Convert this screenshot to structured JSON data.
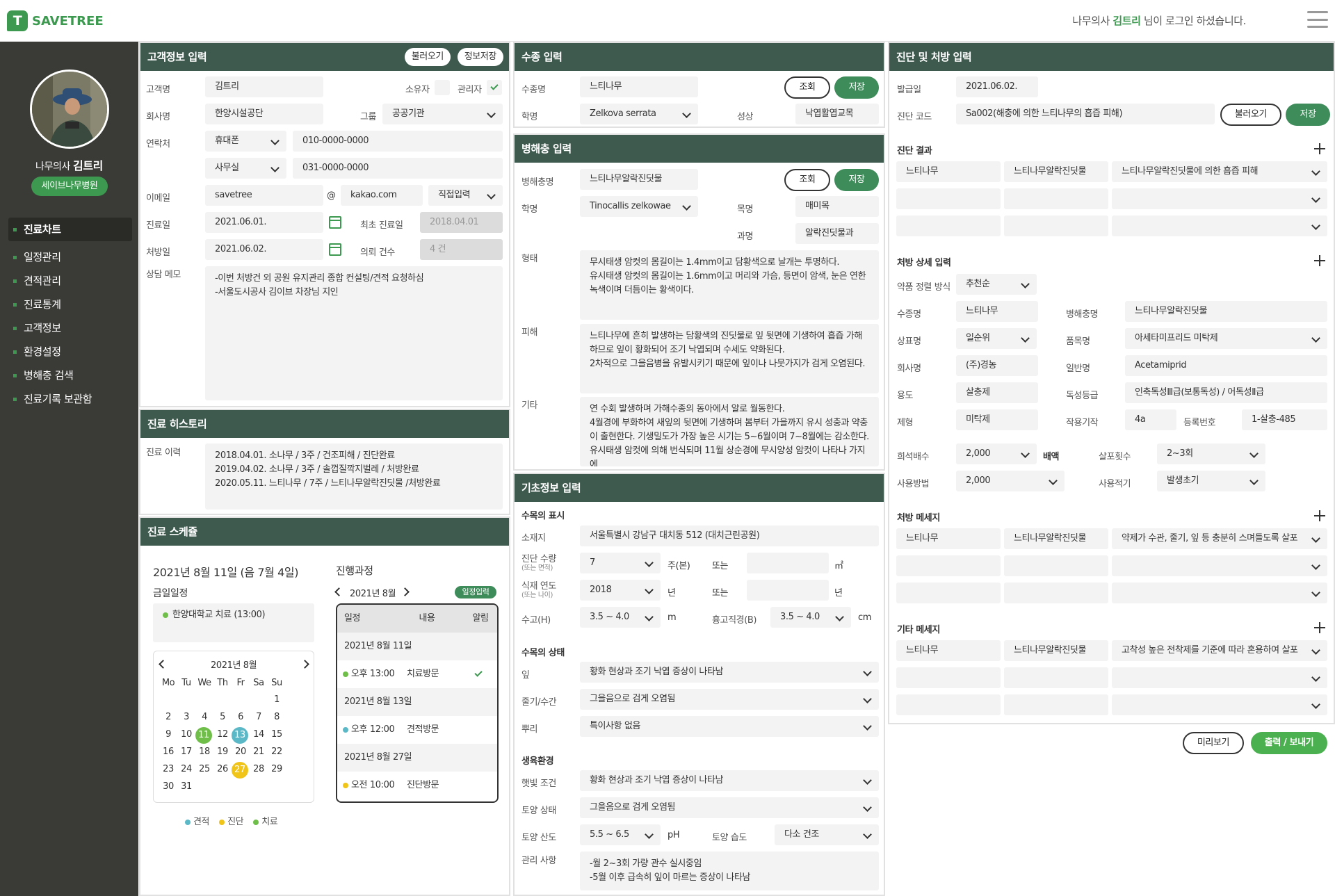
{
  "brand": {
    "logo_letter": "T",
    "name": "SAVETREE"
  },
  "header": {
    "login_prefix": "나무의사",
    "user_name": "김트리",
    "login_suffix": "님이 로그인 하셨습니다."
  },
  "profile": {
    "title": "나무의사",
    "name": "김트리",
    "hospital": "세이브나무병원"
  },
  "nav": [
    "진료차트",
    "일정관리",
    "견적관리",
    "진료통계",
    "고객정보",
    "환경설정",
    "병해충 검색",
    "진료기록 보관함"
  ],
  "customer": {
    "title": "고객정보 입력",
    "load_btn": "불러오기",
    "save_btn": "정보저장",
    "name_label": "고객명",
    "name": "김트리",
    "owner_label": "소유자",
    "manager_label": "관리자",
    "company_label": "회사명",
    "company": "한양시설공단",
    "group_label": "그룹",
    "group": "공공기관",
    "contact_label": "연락처",
    "phone1_type": "휴대폰",
    "phone1": "010-0000-0000",
    "phone2_type": "사무실",
    "phone2": "031-0000-0000",
    "email_label": "이메일",
    "email_id": "savetree",
    "at": "@",
    "email_domain": "kakao.com",
    "email_select": "직접입력",
    "visit_label": "진료일",
    "visit_date": "2021.06.01.",
    "first_visit_label": "최초 진료일",
    "first_visit": "2018.04.01",
    "rx_label": "처방일",
    "rx_date": "2021.06.02.",
    "requests_label": "의뢰 건수",
    "requests": "4 건",
    "memo_label": "상담 메모",
    "memo": "-이번 처방건 외 공원 유지관리 종합 컨설팅/견적 요청하심\n-서울도시공사 김이브 차장님 지인"
  },
  "history": {
    "title": "진료 히스토리",
    "label": "진료 이력",
    "text": "2018.04.01. 소나무 / 3주 / 건조피해 / 진단완료\n2019.04.02. 소나무 / 3주 / 솔껍질깍지벌레 / 처방완료\n2020.05.11. 느티나무 / 7주 / 느티나무알락진딧물 /처방완료"
  },
  "schedule": {
    "title": "진료 스케쥴",
    "today": "2021년 8월 11일 (음 7월 4일)",
    "today_label": "금일일정",
    "today_item": "한양대학교 치료 (13:00)",
    "cal_month": "2021년 8월",
    "weekdays": [
      "Mo",
      "Tu",
      "We",
      "Th",
      "Fr",
      "Sa",
      "Su"
    ],
    "legend": [
      "견적",
      "진단",
      "치료"
    ],
    "progress_title": "진행과정",
    "progress_month": "2021년 8월",
    "add_btn": "일정입력",
    "cols": [
      "일정",
      "내용",
      "알림"
    ],
    "groups": [
      {
        "date": "2021년 8월 11일",
        "time": "오후 13:00",
        "content": "치료방문"
      },
      {
        "date": "2021년 8월 13일",
        "time": "오후 12:00",
        "content": "견적방문"
      },
      {
        "date": "2021년 8월 27일",
        "time": "오전 10:00",
        "content": "진단방문"
      }
    ]
  },
  "species": {
    "title": "수종 입력",
    "label": "수종명",
    "value": "느티나무",
    "lookup": "조회",
    "save": "저장",
    "sci_label": "학명",
    "sci": "Zelkova serrata",
    "habit_label": "성상",
    "habit": "낙엽활엽교목"
  },
  "pest": {
    "title": "병해충 입력",
    "label": "병해충명",
    "value": "느티나무알락진딧물",
    "lookup": "조회",
    "save": "저장",
    "sci_label": "학명",
    "sci": "Tinocallis zelkowae",
    "order_label": "목명",
    "order": "매미목",
    "family_label": "과명",
    "family": "알락진딧물과",
    "shape_label": "형태",
    "shape": "무시태생 암컷의 몸길이는 1.4mm이고 담황색으로 날개는 투명하다.\n유시태생 암컷의 몸길이는 1.6mm이고 머리와 가슴, 등면이 암색, 눈은 연한 녹색이며 더듬이는 황색이다.",
    "damage_label": "피해",
    "damage": "느티나무에 흔히 발생하는 담황색의 진딧물로 잎 뒷면에 기생하여 흡즙 가해하므로 잎이 황화되어 조기 낙엽되며 수세도 약화된다.\n2차적으로 그을음병을 유발시키기 때문에 잎이나 나뭇가지가 검게 오염된다.",
    "etc_label": "기타",
    "etc": "연 수회 발생하며 가해수종의 동아에서 알로 월동한다.\n4월경에 부화하여 새잎의 뒷면에 기생하며 봄부터 가을까지 유시 성충과 약충이 출현한다. 기생밀도가 가장 높은 시기는 5~6월이며 7~8월에는 감소한다. 유시태생 암컷에 의해 번식되며 11월 상순경에 무시양성 암컷이 나타나 가지에"
  },
  "basic": {
    "title": "기초정보 입력",
    "tree_display": "수목의 표시",
    "location_label": "소재지",
    "location": "서울특별시 강남구 대치동 512 (대치근린공원)",
    "count_label": "진단 수량",
    "count_sub": "(또는 면적)",
    "count": "7",
    "count_unit": "주(본)",
    "or": "또는",
    "area_unit": "㎡",
    "year_label": "식재 연도",
    "year_sub": "(또는 나이)",
    "year": "2018",
    "year_unit": "년",
    "age_unit": "년",
    "height_label": "수고(H)",
    "height": "3.5 ~ 4.0",
    "height_unit": "m",
    "dbh_label": "흉고직경(B)",
    "dbh": "3.5 ~ 4.0",
    "dbh_unit": "cm",
    "state_title": "수목의 상태",
    "leaf_label": "잎",
    "leaf": "황화 현상과 조기 낙엽 증상이 나타남",
    "stem_label": "줄기/수간",
    "stem": "그을음으로 검게 오염됨",
    "root_label": "뿌리",
    "root": "특이사항 없음",
    "env_title": "생육환경",
    "sun_label": "햇빛 조건",
    "sun": "황화 현상과 조기 낙엽 증상이 나타남",
    "soil_label": "토양 상태",
    "soil": "그을음으로 검게 오염됨",
    "ph_label": "토양 산도",
    "ph": "5.5 ~ 6.5",
    "ph_unit": "pH",
    "moist_label": "토양 습도",
    "moist": "다소 건조",
    "mgmt_label": "관리 사항",
    "mgmt": "-월 2~3회 가량 관수 실시중임\n-5월 이후 급속히 잎이 마르는 증상이 나타남"
  },
  "diag": {
    "title": "진단 및 처방 입력",
    "issue_label": "발급일",
    "issue": "2021.06.02.",
    "code_label": "진단 코드",
    "code": "Sa002(해충에 의한 느티나무의 흡즙 피해)",
    "load": "불러오기",
    "save": "저장",
    "result_title": "진단 결과",
    "results": [
      "느티나무",
      "느티나무알락진딧물",
      "느티나무알락진딧물에 의한 흡즙 피해"
    ],
    "rx_title": "처방 상세 입력",
    "method_label": "약품 정렬 방식",
    "method": "추천순",
    "species_label": "수종명",
    "species": "느티나무",
    "pest_label": "병해충명",
    "pest": "느티나무알락진딧물",
    "brand_label": "상표명",
    "brand": "일순위",
    "product_label": "품목명",
    "product": "아세타미프리드 미탁제",
    "maker_label": "회사명",
    "maker": "(주)경농",
    "generic_label": "일반명",
    "generic": "Acetamiprid",
    "use_label": "용도",
    "use": "살충제",
    "tox_label": "독성등급",
    "tox": "인축독성Ⅲ급(보통독성) / 어독성Ⅱ급",
    "form_label": "제형",
    "form": "미탁제",
    "moa_label": "작용기작",
    "moa": "4a",
    "reg_label": "등록번호",
    "reg": "1-살충-485",
    "dil_label": "희석배수",
    "dil": "2,000",
    "dil_unit": "배액",
    "times_label": "살포횟수",
    "times": "2~3회",
    "how_label": "사용방법",
    "how": "2,000",
    "when_label": "사용적기",
    "when": "발생초기",
    "msg_title": "처방 메세지",
    "msgs": [
      "느티나무",
      "느티나무알락진딧물",
      "약제가 수관, 줄기, 잎 등 충분히 스며들도록 살포"
    ],
    "etc_title": "기타 메세지",
    "etcs": [
      "느티나무",
      "느티나무알락진딧물",
      "고착성 높은 전착제를 기준에 따라 혼용하여 살포"
    ],
    "preview": "미리보기",
    "print": "출력 / 보내기"
  },
  "colors": {
    "header": "#3e5a4f",
    "green": "#3d9950",
    "estimate": "#5bb8c6",
    "diagnosis": "#f0c419",
    "treatment": "#6fbe4a"
  }
}
